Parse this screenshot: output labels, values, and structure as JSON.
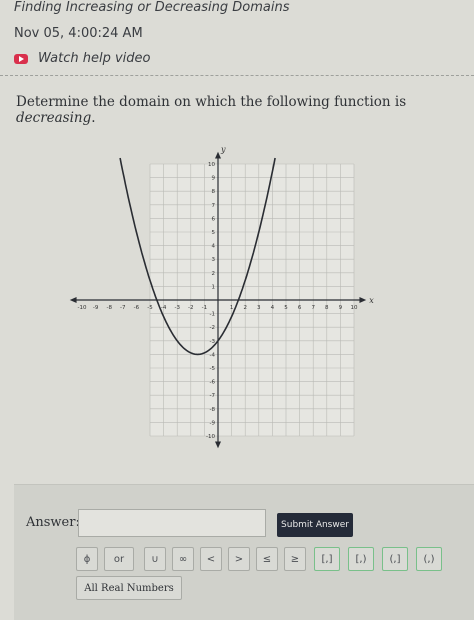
{
  "header": {
    "title": "Finding Increasing or Decreasing Domains",
    "timestamp": "Nov 05, 4:00:24 AM",
    "help_link": "Watch help video"
  },
  "question": {
    "prefix": "Determine the domain on which the following function is ",
    "emphasis": "decreasing",
    "suffix": "."
  },
  "graph": {
    "x_label": "x",
    "y_label": "y",
    "x_ticks": [
      "-10",
      "-9",
      "-8",
      "-7",
      "-6",
      "-5",
      "-4",
      "-3",
      "-2",
      "-1",
      "1",
      "2",
      "3",
      "4",
      "5",
      "6",
      "7",
      "8",
      "9",
      "10"
    ],
    "y_ticks": [
      "10",
      "9",
      "8",
      "7",
      "6",
      "5",
      "4",
      "3",
      "2",
      "1",
      "-1",
      "-2",
      "-3",
      "-4",
      "-5",
      "-6",
      "-7",
      "-8",
      "-9",
      "-10"
    ],
    "xlim": [
      -10,
      10
    ],
    "ylim": [
      -10,
      10
    ],
    "curve_vertex": [
      -1.5,
      -4
    ],
    "curve_y_intercept": -3,
    "curve_x_intercepts": [
      -4.5,
      1.5
    ],
    "grid": true
  },
  "answer": {
    "label": "Answer:",
    "input_value": "",
    "submit_label": "Submit Answer",
    "keys": [
      "ϕ",
      "or",
      "∪",
      "∞",
      "<",
      ">",
      "≤",
      "≥",
      "[,]",
      "[,)",
      "(,]",
      "(,)"
    ],
    "all_real_label": "All Real Numbers"
  }
}
